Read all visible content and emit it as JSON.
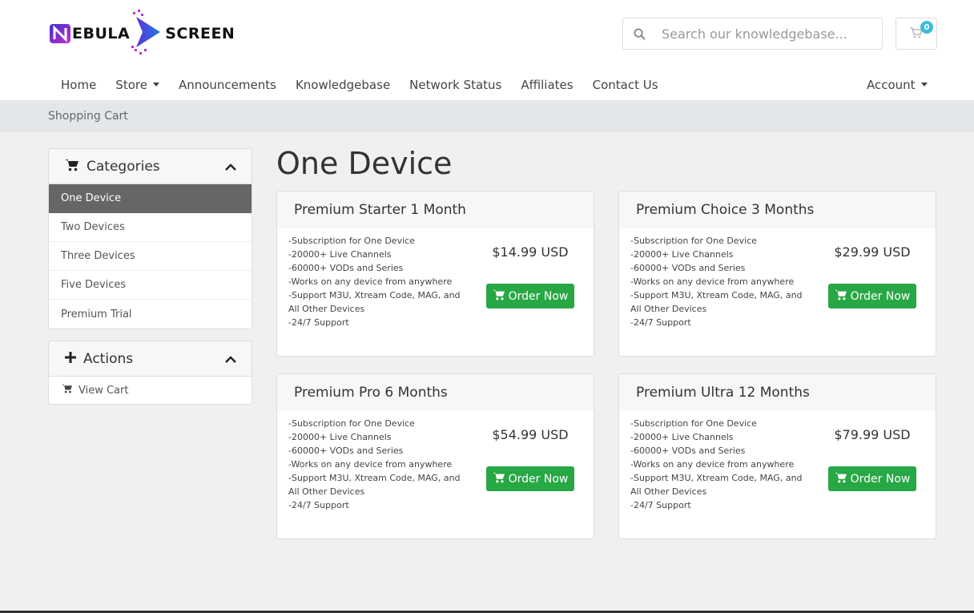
{
  "brand": {
    "logo_text_left": "EBULA",
    "logo_text_right": "SCREEN",
    "accent_color": "#28a745",
    "badge_color": "#3dbbd8"
  },
  "header": {
    "search_placeholder": "Search our knowledgebase...",
    "cart_count": "0"
  },
  "nav": {
    "items": [
      {
        "label": "Home",
        "dropdown": false
      },
      {
        "label": "Store",
        "dropdown": true
      },
      {
        "label": "Announcements",
        "dropdown": false
      },
      {
        "label": "Knowledgebase",
        "dropdown": false
      },
      {
        "label": "Network Status",
        "dropdown": false
      },
      {
        "label": "Affiliates",
        "dropdown": false
      },
      {
        "label": "Contact Us",
        "dropdown": false
      }
    ],
    "account_label": "Account"
  },
  "breadcrumb": {
    "current": "Shopping Cart"
  },
  "sidebar": {
    "categories_title": "Categories",
    "categories": [
      {
        "label": "One Device",
        "active": true
      },
      {
        "label": "Two Devices",
        "active": false
      },
      {
        "label": "Three Devices",
        "active": false
      },
      {
        "label": "Five Devices",
        "active": false
      },
      {
        "label": "Premium Trial",
        "active": false
      }
    ],
    "actions_title": "Actions",
    "actions": [
      {
        "label": "View Cart",
        "icon": "cart-icon"
      }
    ]
  },
  "main": {
    "title": "One Device",
    "order_label": "Order Now",
    "products": [
      {
        "name": "Premium Starter 1 Month",
        "price": "$14.99 USD",
        "features": [
          "-Subscription for One Device",
          "-20000+ Live Channels",
          "-60000+ VODs and Series",
          "-Works on any device from anywhere",
          "-Support M3U, Xtream Code, MAG, and All Other Devices",
          "-24/7 Support"
        ]
      },
      {
        "name": "Premium Choice 3 Months",
        "price": "$29.99 USD",
        "features": [
          "-Subscription for One Device",
          "-20000+ Live Channels",
          "-60000+ VODs and Series",
          "-Works on any device from anywhere",
          "-Support M3U, Xtream Code, MAG, and All Other Devices",
          "-24/7 Support"
        ]
      },
      {
        "name": "Premium Pro 6 Months",
        "price": "$54.99 USD",
        "features": [
          "-Subscription for One Device",
          "-20000+ Live Channels",
          "-60000+ VODs and Series",
          "-Works on any device from anywhere",
          "-Support M3U, Xtream Code, MAG, and All Other Devices",
          "-24/7 Support"
        ]
      },
      {
        "name": "Premium Ultra 12 Months",
        "price": "$79.99 USD",
        "features": [
          "-Subscription for One Device",
          "-20000+ Live Channels",
          "-60000+ VODs and Series",
          "-Works on any device from anywhere",
          "-Support M3U, Xtream Code, MAG, and All Other Devices",
          "-24/7 Support"
        ]
      }
    ]
  }
}
